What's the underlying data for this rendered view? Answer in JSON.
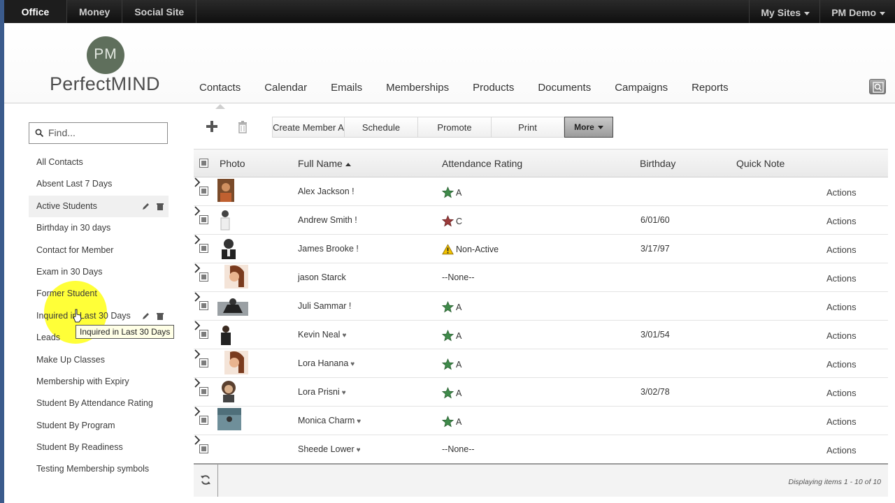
{
  "topbar": {
    "left": [
      {
        "label": "Office",
        "active": true
      },
      {
        "label": "Money"
      },
      {
        "label": "Social Site"
      }
    ],
    "right": [
      {
        "label": "My Sites"
      },
      {
        "label": "PM Demo"
      }
    ]
  },
  "logo": {
    "circle_text": "PM",
    "name": "PerfectMIND",
    "color": "#5f6f5c"
  },
  "mainnav": [
    "Contacts",
    "Calendar",
    "Emails",
    "Memberships",
    "Products",
    "Documents",
    "Campaigns",
    "Reports"
  ],
  "search": {
    "placeholder": "Find..."
  },
  "sidebar": {
    "items": [
      "All Contacts",
      "Absent Last 7 Days",
      "Active Students",
      "Birthday in 30 days",
      "Contact for Member",
      "Exam in 30 Days",
      "Former Student",
      "Inquired in Last 30 Days",
      "Leads",
      "Make Up Classes",
      "Membership with Expiry",
      "Student By Attendance Rating",
      "Student By Program",
      "Student By Readiness",
      "Testing Membership symbols"
    ],
    "tooltip": "Inquired in Last 30 Days"
  },
  "toolbar": {
    "buttons": [
      "Create Member A",
      "Schedule",
      "Promote",
      "Print"
    ],
    "more": "More"
  },
  "table": {
    "headers": {
      "photo": "Photo",
      "name": "Full Name",
      "attendance": "Attendance Rating",
      "birthday": "Birthday",
      "note": "Quick Note"
    },
    "actions_label": "Actions",
    "rows": [
      {
        "name": "Alex Jackson !",
        "attendance": "A",
        "att_icon": "green-star-icon",
        "birthday": ""
      },
      {
        "name": "Andrew Smith !",
        "attendance": "C",
        "att_icon": "red-star-icon",
        "birthday": "6/01/60"
      },
      {
        "name": "James Brooke !",
        "attendance": "Non-Active",
        "att_icon": "warning-icon",
        "birthday": "3/17/97"
      },
      {
        "name": "jason Starck",
        "attendance": "--None--",
        "att_icon": "",
        "birthday": ""
      },
      {
        "name": "Juli Sammar !",
        "attendance": "A",
        "att_icon": "green-star-icon",
        "birthday": ""
      },
      {
        "name": "Kevin Neal",
        "attendance": "A",
        "att_icon": "green-star-icon",
        "birthday": "3/01/54"
      },
      {
        "name": "Lora Hanana",
        "attendance": "A",
        "att_icon": "green-star-icon",
        "birthday": ""
      },
      {
        "name": "Lora Prisni",
        "attendance": "A",
        "att_icon": "green-star-icon",
        "birthday": "3/02/78"
      },
      {
        "name": "Monica Charm",
        "attendance": "A",
        "att_icon": "green-star-icon",
        "birthday": ""
      },
      {
        "name": "Sheede Lower",
        "attendance": "--None--",
        "att_icon": "",
        "birthday": ""
      }
    ],
    "footer": "Displaying items 1 - 10 of 10"
  },
  "colors": {
    "green_star": "#3f8a4a",
    "red_star": "#9b3a3a",
    "warning": "#f2c200",
    "highlight": "#ffff00"
  }
}
